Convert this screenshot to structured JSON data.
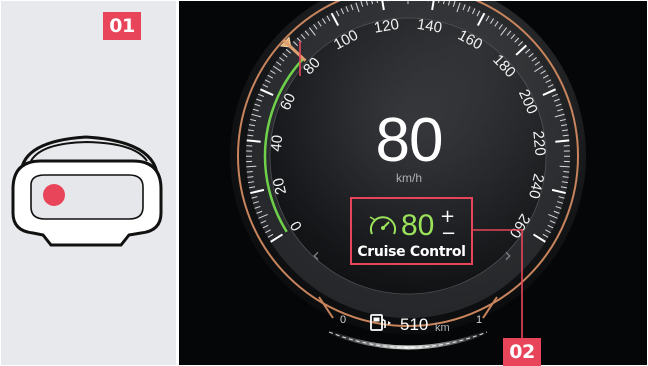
{
  "callouts": {
    "marker_1": "01",
    "marker_2": "02"
  },
  "speedometer": {
    "current_speed": "80",
    "unit": "km/h",
    "scale_labels": [
      "0",
      "20",
      "40",
      "60",
      "80",
      "100",
      "120",
      "140",
      "160",
      "180",
      "200",
      "220",
      "240",
      "260"
    ],
    "set_speed_fraction_of_scale": 0.307,
    "speed_fraction_of_scale": 0.307
  },
  "cruise_control": {
    "icon": "speedometer-gauge-icon",
    "set_speed": "80",
    "plus": "+",
    "minus": "−",
    "label": "Cruise Control"
  },
  "range_display": {
    "icon": "fuel-pump-icon",
    "value": "510",
    "unit": "km"
  },
  "fuel_bar": {
    "left_label": "0",
    "right_label": "1"
  },
  "navigation": {
    "prev": "‹",
    "next": "›"
  },
  "colors": {
    "accent_copper": "#c8845c",
    "speed_arc_green": "#6fd14a",
    "callout_red": "#e8455a",
    "cruise_green": "#9be35a",
    "dot_red": "#e8455a"
  }
}
